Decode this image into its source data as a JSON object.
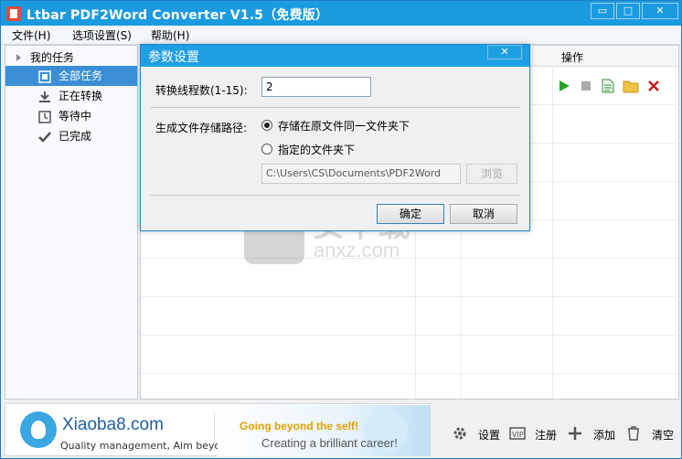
{
  "window": {
    "title": "Ltbar PDF2Word Converter V1.5（免费版）",
    "controls": {
      "minimize": "▭",
      "maximize": "□",
      "close": "✕"
    }
  },
  "menubar": {
    "items": [
      "文件(H)",
      "选项设置(S)",
      "帮助(H)"
    ]
  },
  "sidebar": {
    "root": "我的任务",
    "items": [
      {
        "label": "全部任务",
        "icon": "all-tasks-icon",
        "selected": true
      },
      {
        "label": "正在转换",
        "icon": "download-icon",
        "selected": false
      },
      {
        "label": "等待中",
        "icon": "clock-icon",
        "selected": false
      },
      {
        "label": "已完成",
        "icon": "checkmark-icon",
        "selected": false
      }
    ]
  },
  "grid": {
    "header_ops": "操作",
    "ops": [
      "play-icon",
      "stop-icon",
      "document-icon",
      "folder-icon",
      "delete-icon"
    ]
  },
  "dialog": {
    "title": "参数设置",
    "close": "✕",
    "threads_label": "转换线程数(1-15):",
    "threads_value": "2",
    "path_label": "生成文件存储路径:",
    "option_same_folder": "存储在原文件同一文件夹下",
    "option_custom_folder": "指定的文件夹下",
    "selected_option": "same_folder",
    "path_value": "C:\\Users\\CS\\Documents\\PDF2Word",
    "browse": "浏览",
    "ok": "确定",
    "cancel": "取消"
  },
  "footer": {
    "ad": {
      "brand": "Xiaoba8.com",
      "tagline": "Quality management, Aim beyond",
      "slogan1": "Going beyond the self!",
      "slogan2": "Creating a brilliant career!"
    },
    "buttons": [
      {
        "label": "设置",
        "icon": "gear-icon"
      },
      {
        "label": "注册",
        "icon": "vip-icon"
      },
      {
        "label": "添加",
        "icon": "plus-icon"
      },
      {
        "label": "清空",
        "icon": "trash-icon"
      }
    ]
  },
  "watermark": {
    "text": "安下载",
    "url": "anxz.com"
  },
  "colors": {
    "title_bar": "#1a9be0",
    "selected_item": "#3c8fd6",
    "dialog_title": "#1f9fe3",
    "ad_gold": "#e1a300"
  }
}
